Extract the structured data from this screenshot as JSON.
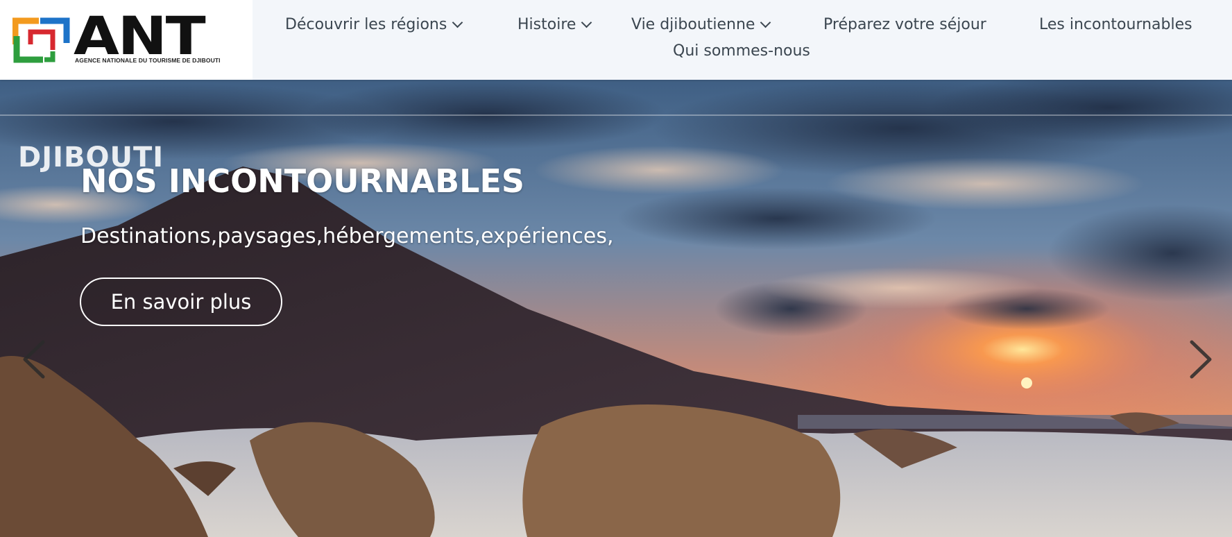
{
  "brand": {
    "logo_text": "ANT",
    "tagline": "AGENCE NATIONALE DU TOURISME DE DJIBOUTI",
    "colors": {
      "orange": "#f39a1e",
      "blue": "#1d73c8",
      "green": "#2e9e3e",
      "red": "#d7282f"
    }
  },
  "nav": {
    "items": [
      {
        "label": "Découvrir les régions",
        "has_dropdown": true
      },
      {
        "label": "Histoire",
        "has_dropdown": true
      },
      {
        "label": "Vie djiboutienne",
        "has_dropdown": true
      },
      {
        "label": "Préparez votre séjour",
        "has_dropdown": false
      },
      {
        "label": "Les incontournables",
        "has_dropdown": false
      },
      {
        "label": "Qui sommes-nous",
        "has_dropdown": false
      }
    ]
  },
  "hero": {
    "eyebrow": "DJIBOUTI",
    "title": "NOS INCONTOURNABLES",
    "subtitle": "Destinations,paysages,hébergements,expériences,",
    "cta_label": "En savoir plus",
    "prev_icon": "chevron-left-icon",
    "next_icon": "chevron-right-icon"
  }
}
